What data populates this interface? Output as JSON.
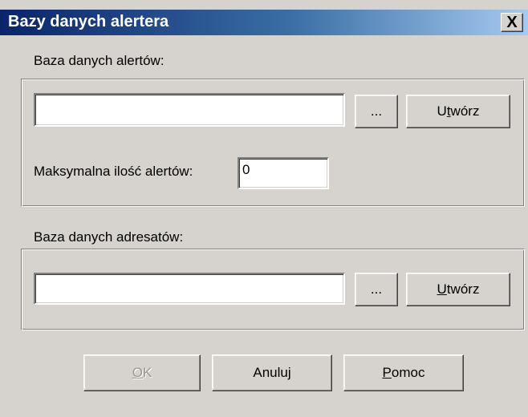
{
  "window": {
    "title": "Bazy danych alertera",
    "close_glyph": "X",
    "close_icon": "close-icon"
  },
  "alerts_db": {
    "label": "Baza danych alertów:",
    "path_value": "",
    "browse_label": "...",
    "create_label_pre": "U",
    "create_label_u": "t",
    "create_label_post": "wórz",
    "max_label": "Maksymalna ilość alertów:",
    "max_value": "0"
  },
  "recipients_db": {
    "label": "Baza danych adresatów:",
    "path_value": "",
    "browse_label": "...",
    "create_label_u": "U",
    "create_label_post": "twórz"
  },
  "footer": {
    "ok_u": "O",
    "ok_post": "K",
    "cancel_label": "Anuluj",
    "help_u": "P",
    "help_post": "omoc"
  }
}
